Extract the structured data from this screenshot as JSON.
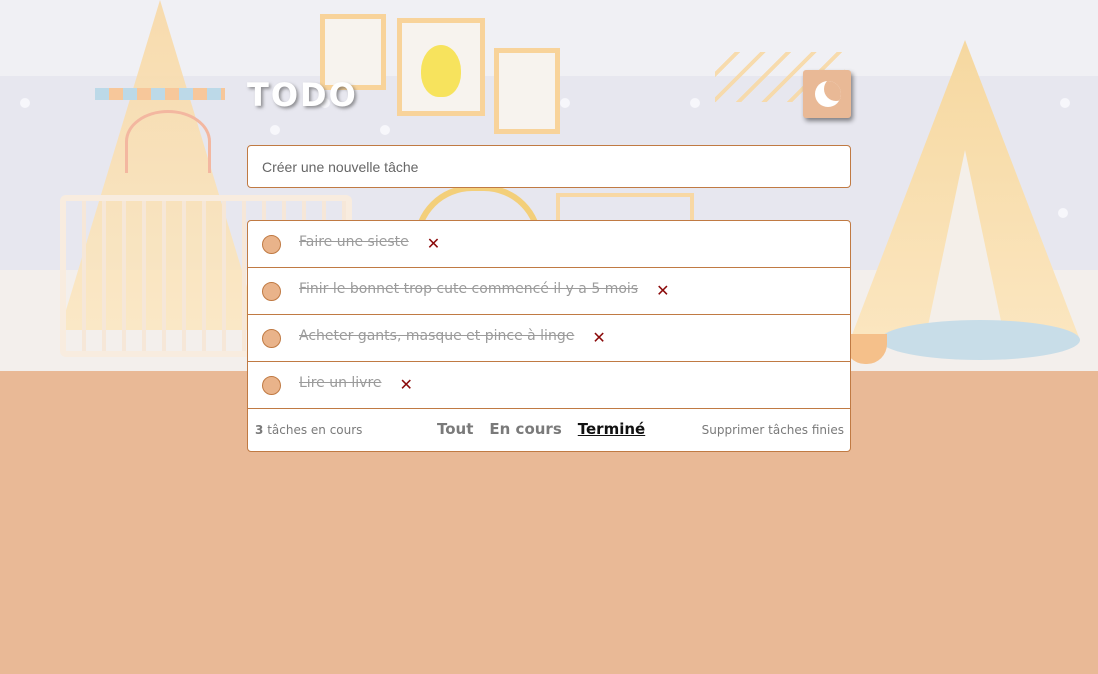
{
  "app": {
    "title": "TODO"
  },
  "new_task": {
    "placeholder": "Créer une nouvelle tâche"
  },
  "todos": [
    {
      "text": "Faire une sieste",
      "completed": true
    },
    {
      "text": "Finir le bonnet trop cute commencé il y a 5 mois",
      "completed": true
    },
    {
      "text": "Acheter gants, masque et pince à linge",
      "completed": true
    },
    {
      "text": "Lire un livre",
      "completed": true
    }
  ],
  "footer": {
    "count": "3",
    "count_label": "tâches en cours",
    "filters": [
      "Tout",
      "En cours",
      "Terminé"
    ],
    "active_filter": "Terminé",
    "clear_label": "Supprimer tâches finies"
  },
  "icons": {
    "theme": "moon-icon",
    "delete": "close-icon",
    "check": "circle-check-icon"
  },
  "colors": {
    "accent": "#e9b996",
    "border": "#c07a43",
    "delete": "#8b0a0a"
  }
}
